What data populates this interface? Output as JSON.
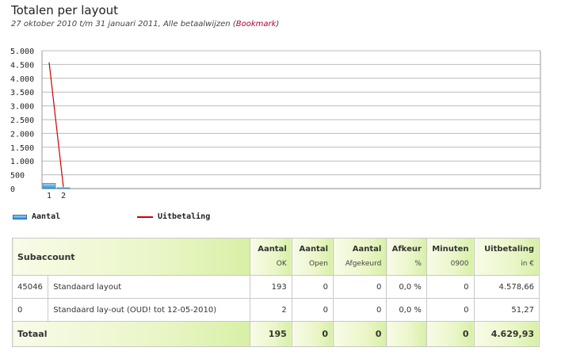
{
  "page": {
    "title": "Totalen per layout",
    "subtitle": "27 oktober 2010 t/m 31 januari 2011, Alle betaalwijzen (",
    "bookmark_label": "Bookmark",
    "subtitle_close": ")"
  },
  "legend": {
    "bar_label": "Aantal",
    "line_label": "Uitbetaling"
  },
  "chart_data": {
    "type": "bar",
    "categories": [
      "1",
      "2"
    ],
    "y_ticks": [
      "5.000",
      "4.500",
      "4.000",
      "3.500",
      "3.000",
      "2.500",
      "2.000",
      "1.500",
      "1.000",
      "500",
      "0"
    ],
    "ylim": [
      0,
      5000
    ],
    "series": [
      {
        "name": "Aantal",
        "type": "bar",
        "values": [
          193,
          2
        ],
        "color": "#3a95d6"
      },
      {
        "name": "Uitbetaling",
        "type": "line",
        "values": [
          4578.66,
          51.27
        ],
        "color": "#cc0000"
      }
    ],
    "grid": true,
    "legend_position": "bottom-left"
  },
  "table": {
    "header": {
      "subaccount": "Subaccount",
      "cols": [
        {
          "label": "Aantal",
          "sub": "OK"
        },
        {
          "label": "Aantal",
          "sub": "Open"
        },
        {
          "label": "Aantal",
          "sub": "Afgekeurd"
        },
        {
          "label": "Afkeur",
          "sub": "%"
        },
        {
          "label": "Minuten",
          "sub": "0900"
        },
        {
          "label": "Uitbetaling",
          "sub": "in €"
        }
      ]
    },
    "rows": [
      {
        "id": "45046",
        "name": "Standaard layout",
        "ok": "193",
        "open": "0",
        "afgekeurd": "0",
        "afkeur": "0,0 %",
        "minuten": "0",
        "uitbetaling": "4.578,66"
      },
      {
        "id": "0",
        "name": "Standaard lay-out (OUD! tot 12-05-2010)",
        "ok": "2",
        "open": "0",
        "afgekeurd": "0",
        "afkeur": "0,0 %",
        "minuten": "0",
        "uitbetaling": "51,27"
      }
    ],
    "total": {
      "label": "Totaal",
      "ok": "195",
      "open": "0",
      "afgekeurd": "0",
      "afkeur": "",
      "minuten": "0",
      "uitbetaling": "4.629,93"
    }
  }
}
